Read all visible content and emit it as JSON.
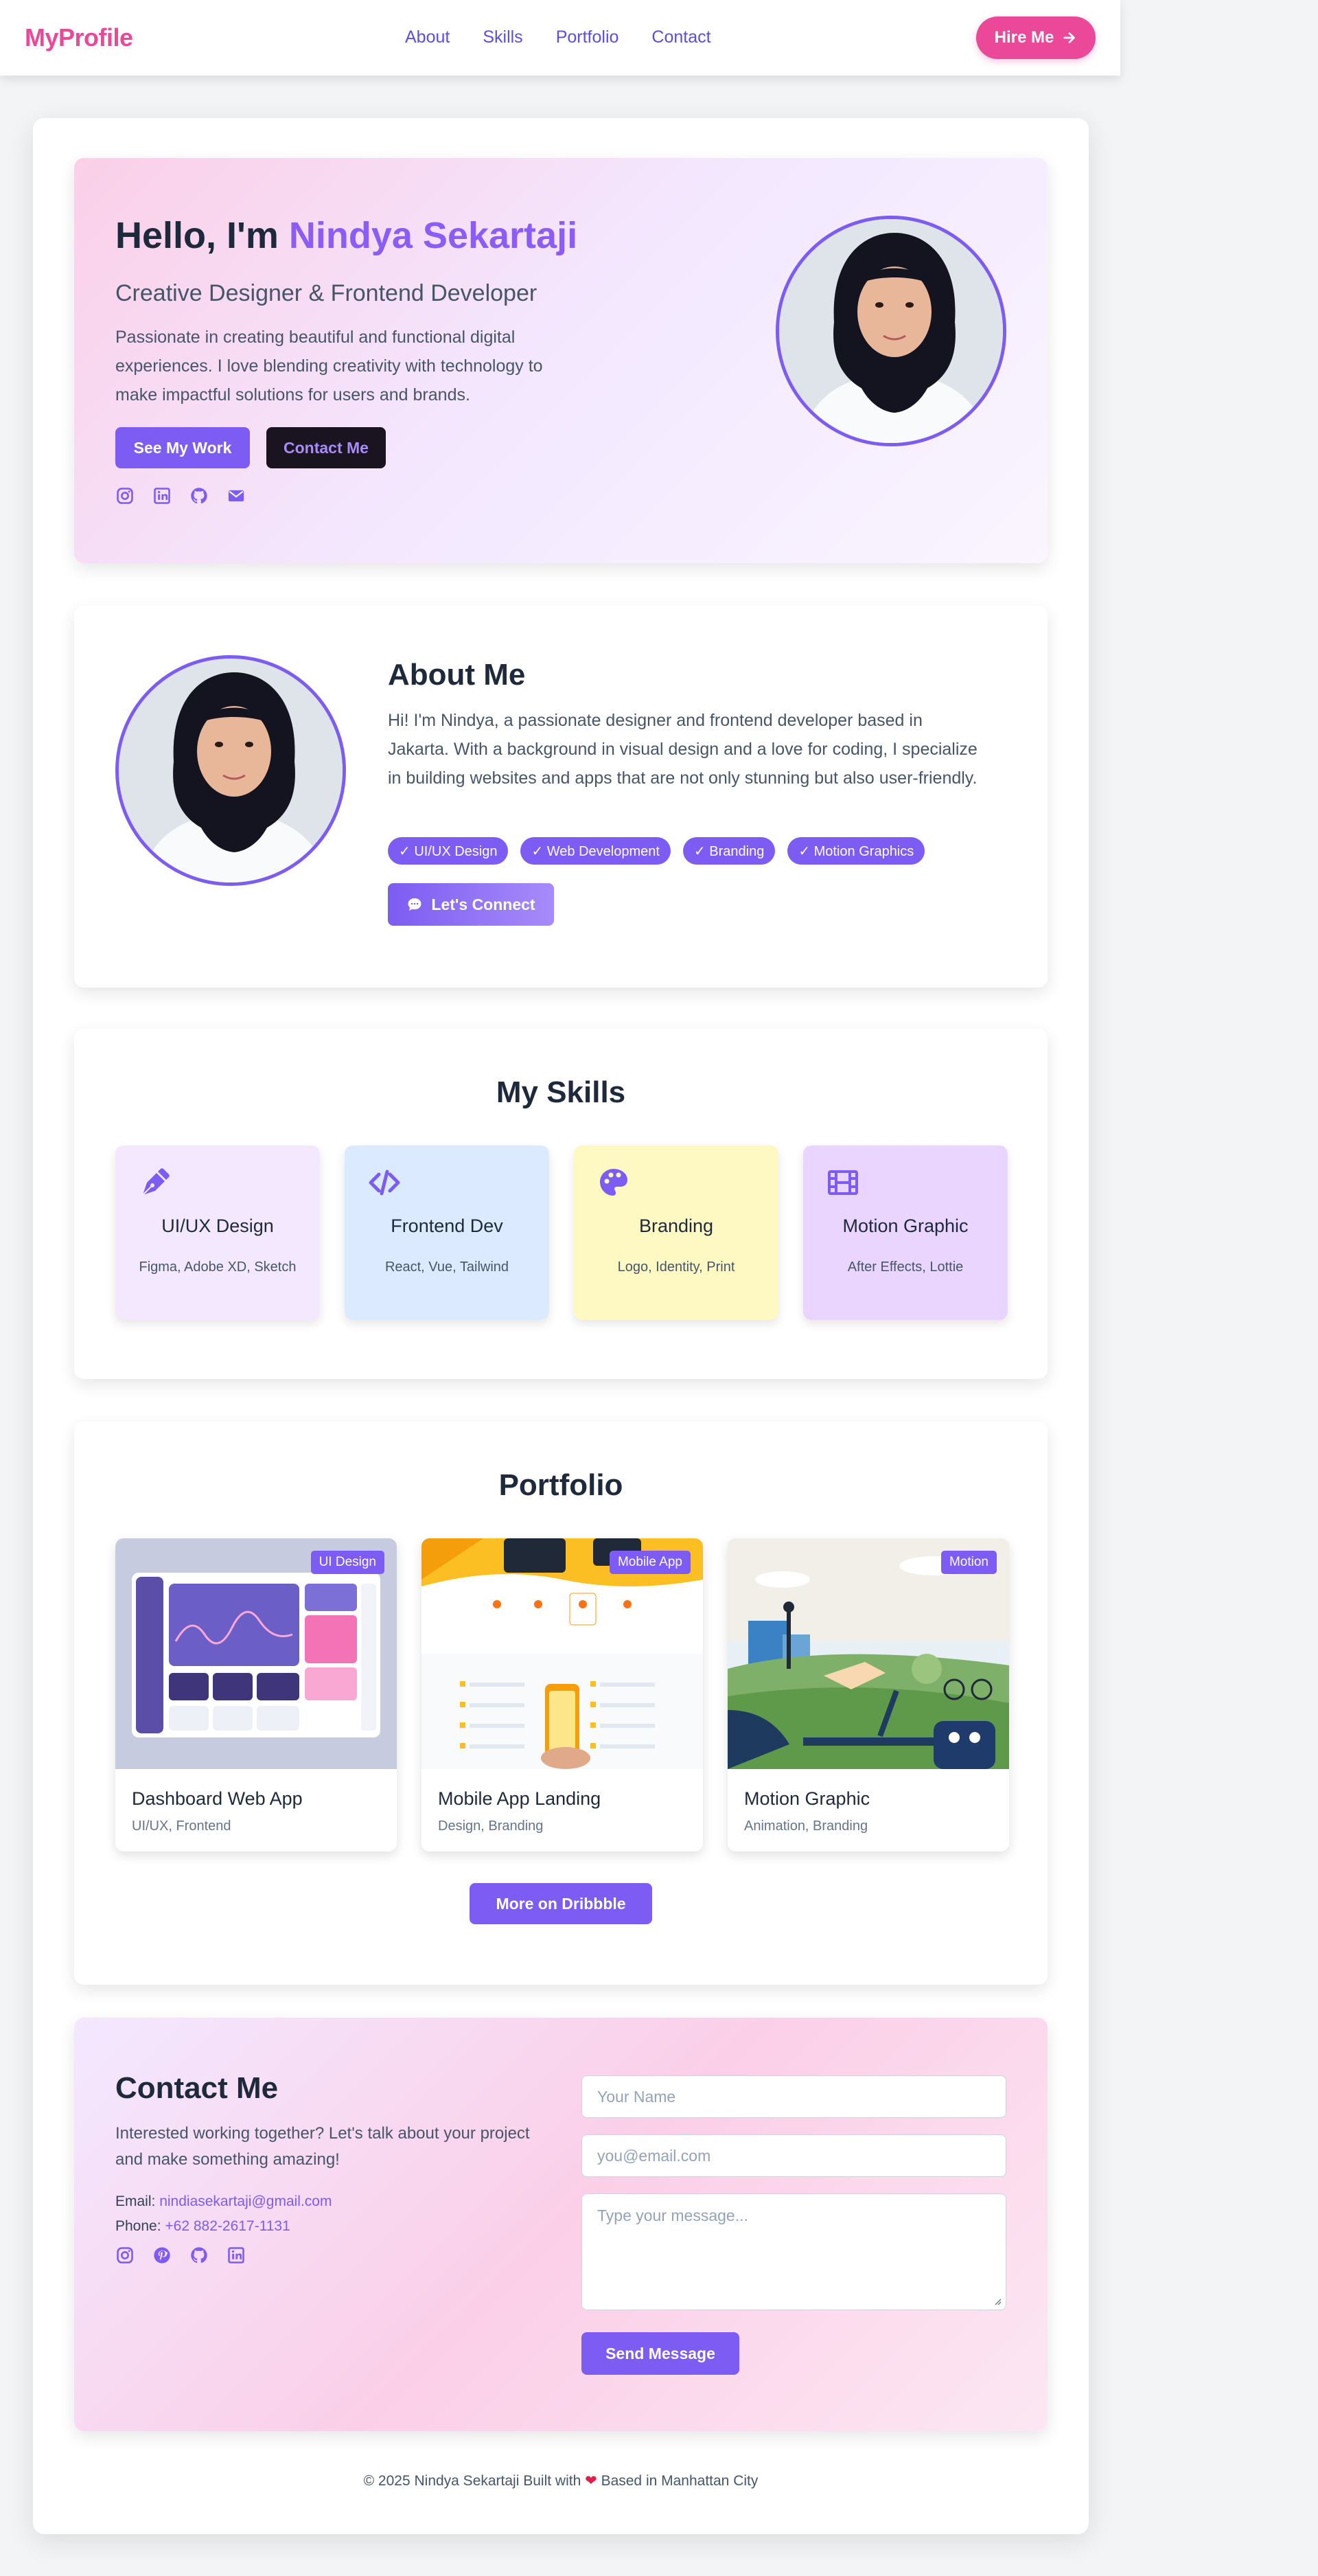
{
  "nav": {
    "brand": "MyProfile",
    "links": [
      "About",
      "Skills",
      "Portfolio",
      "Contact"
    ],
    "hire_label": "Hire Me"
  },
  "hero": {
    "greeting": "Hello, I'm ",
    "name": "Nindya Sekartaji",
    "role": "Creative Designer & Frontend Developer",
    "description": "Passionate in creating beautiful and functional digital experiences. I love blending creativity with technology to make impactful solutions for users and brands.",
    "primary_button": "See My Work",
    "secondary_button": "Contact Me",
    "social_icons": [
      "instagram-icon",
      "linkedin-icon",
      "github-icon",
      "mail-icon"
    ]
  },
  "about": {
    "title": "About Me",
    "description": "Hi! I'm Nindya, a passionate designer and frontend developer based in Jakarta. With a background in visual design and a love for coding, I specialize in building websites and apps that are not only stunning but also user-friendly.",
    "tags": [
      "✓ UI/UX Design",
      "✓ Web Development",
      "✓ Branding",
      "✓ Motion Graphics"
    ],
    "connect_label": "Let's Connect"
  },
  "skills": {
    "title": "My Skills",
    "items": [
      {
        "title": "UI/UX Design",
        "sub": "Figma, Adobe XD, Sketch",
        "icon": "pen-nib-icon",
        "bg": "#f3e8ff"
      },
      {
        "title": "Frontend Dev",
        "sub": "React, Vue, Tailwind",
        "icon": "code-icon",
        "bg": "#dbeafe"
      },
      {
        "title": "Branding",
        "sub": "Logo, Identity, Print",
        "icon": "palette-icon",
        "bg": "#fef9c3"
      },
      {
        "title": "Motion Graphic",
        "sub": "After Effects, Lottie",
        "icon": "film-icon",
        "bg": "#e9d5ff"
      }
    ]
  },
  "portfolio": {
    "title": "Portfolio",
    "items": [
      {
        "badge": "UI Design",
        "title": "Dashboard Web App",
        "sub": "UI/UX, Frontend"
      },
      {
        "badge": "Mobile App",
        "title": "Mobile App Landing",
        "sub": "Design, Branding"
      },
      {
        "badge": "Motion",
        "title": "Motion Graphic",
        "sub": "Animation, Branding"
      }
    ],
    "more_label": "More on Dribbble"
  },
  "contact": {
    "title": "Contact Me",
    "description": "Interested working together? Let's talk about your project and make something amazing!",
    "email_label": "Email:",
    "email": "nindiasekartaji@gmail.com",
    "phone_label": "Phone:",
    "phone": "+62 882-2617-1131",
    "social_icons": [
      "instagram-icon",
      "pinterest-icon",
      "github-icon",
      "linkedin-icon"
    ],
    "name_placeholder": "Your Name",
    "email_placeholder": "you@email.com",
    "message_placeholder": "Type your message...",
    "send_label": "Send Message"
  },
  "footer": {
    "prefix": "© 2025 Nindya Sekartaji Built with",
    "heart": "❤",
    "suffix": "Based in Manhattan City"
  },
  "colors": {
    "accent": "#7c5cf2",
    "brand": "#ec4899",
    "text": "#1e293b"
  }
}
